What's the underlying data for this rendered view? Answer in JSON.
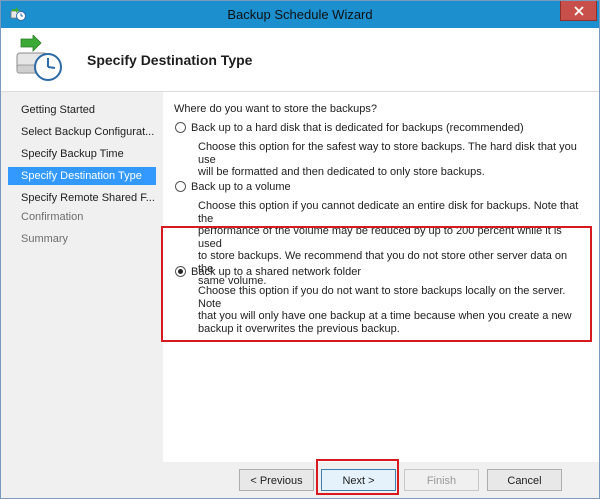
{
  "window": {
    "title": "Backup Schedule Wizard"
  },
  "header": {
    "title": "Specify Destination Type"
  },
  "nav": {
    "items": [
      {
        "label": "Getting Started",
        "state": "normal"
      },
      {
        "label": "Select Backup Configurat...",
        "state": "normal"
      },
      {
        "label": "Specify Backup Time",
        "state": "normal"
      },
      {
        "label": "Specify Destination Type",
        "state": "active"
      },
      {
        "label": "Specify Remote Shared F...",
        "state": "normal"
      },
      {
        "label": "Confirmation",
        "state": "disabled"
      },
      {
        "label": "Summary",
        "state": "disabled"
      }
    ]
  },
  "content": {
    "question": "Where do you want to store the backups?",
    "options": [
      {
        "label": "Back up to a hard disk that is dedicated for backups (recommended)",
        "desc_lines": [
          "Choose this option for the safest way to store backups. The hard disk that you use",
          "will be formatted and then dedicated to only store backups."
        ],
        "checked": false
      },
      {
        "label": "Back up to a volume",
        "desc_lines": [
          "Choose this option if you cannot dedicate an entire disk for backups. Note that the",
          "performance of the volume may be reduced by up to 200 percent while it is used",
          "to store backups. We recommend that you do not store other server data on the",
          "same volume."
        ],
        "checked": false
      },
      {
        "label": "Back up to a shared network folder",
        "desc_lines": [
          "Choose this option if you do not want to store backups locally on the server. Note",
          "that you will only have one backup at a time because when you create a new",
          "backup it overwrites the previous backup."
        ],
        "checked": true
      }
    ]
  },
  "buttons": {
    "previous": "< Previous",
    "next": "Next >",
    "finish": "Finish",
    "cancel": "Cancel"
  },
  "colors": {
    "titlebar": "#1c8fcf",
    "nav_active": "#3399ff",
    "highlight": "#d71920",
    "close_button": "#c7504b"
  },
  "icons": {
    "app": "backup-clock-icon",
    "close": "close-icon",
    "header": "backup-schedule-icon"
  }
}
